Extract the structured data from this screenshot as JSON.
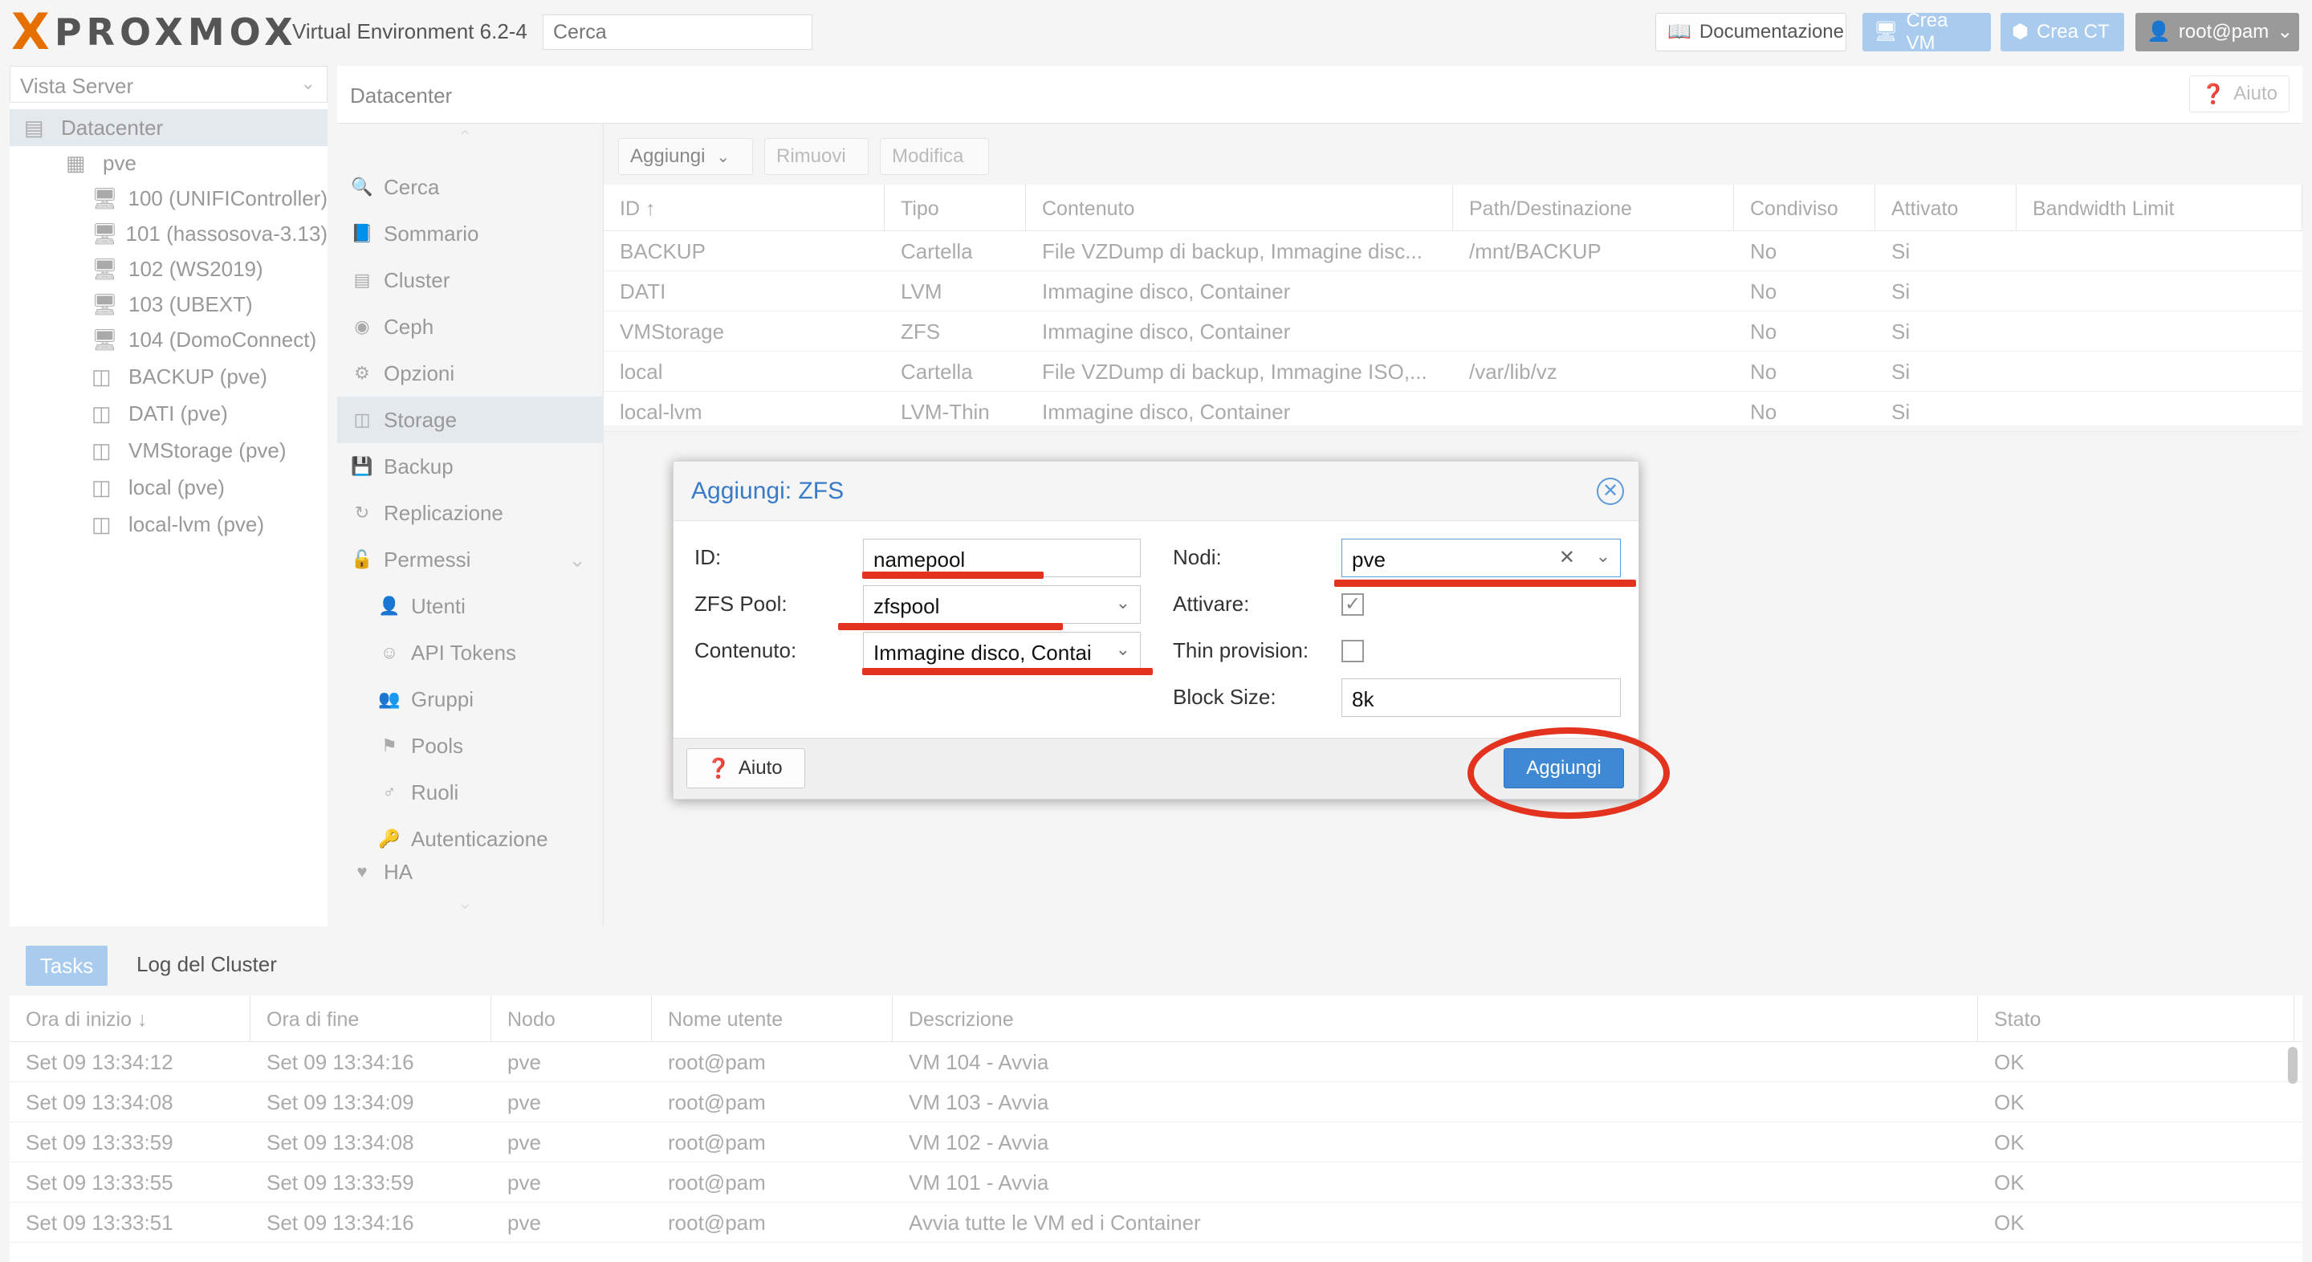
{
  "topbar": {
    "logo_x": "X",
    "logo_text": "PROXMOX",
    "version": "Virtual Environment 6.2-4",
    "search_placeholder": "Cerca",
    "buttons": {
      "docs": "Documentazione",
      "create_vm": "Crea VM",
      "create_ct": "Crea CT",
      "user": "root@pam"
    }
  },
  "tree": {
    "view_selector": "Vista Server",
    "items": [
      {
        "label": "Datacenter",
        "icon": "server-rack-icon"
      },
      {
        "label": "pve",
        "icon": "node-icon"
      },
      {
        "label": "100 (UNIFIController)",
        "icon": "vm-running-icon"
      },
      {
        "label": "101 (hassosova-3.13)",
        "icon": "vm-running-icon"
      },
      {
        "label": "102 (WS2019)",
        "icon": "vm-running-icon"
      },
      {
        "label": "103 (UBEXT)",
        "icon": "vm-running-icon"
      },
      {
        "label": "104 (DomoConnect)",
        "icon": "vm-running-icon"
      },
      {
        "label": "BACKUP (pve)",
        "icon": "storage-icon"
      },
      {
        "label": "DATI (pve)",
        "icon": "storage-icon"
      },
      {
        "label": "VMStorage (pve)",
        "icon": "storage-icon"
      },
      {
        "label": "local (pve)",
        "icon": "storage-icon"
      },
      {
        "label": "local-lvm (pve)",
        "icon": "storage-icon"
      }
    ]
  },
  "content": {
    "breadcrumb": "Datacenter",
    "help_button": "Aiuto",
    "nav": [
      {
        "label": "Cerca",
        "icon": "search-icon",
        "sub": false,
        "selected": false
      },
      {
        "label": "Sommario",
        "icon": "book-icon",
        "sub": false,
        "selected": false
      },
      {
        "label": "Cluster",
        "icon": "cluster-icon",
        "sub": false,
        "selected": false
      },
      {
        "label": "Ceph",
        "icon": "ceph-icon",
        "sub": false,
        "selected": false
      },
      {
        "label": "Opzioni",
        "icon": "gear-icon",
        "sub": false,
        "selected": false
      },
      {
        "label": "Storage",
        "icon": "database-icon",
        "sub": false,
        "selected": true
      },
      {
        "label": "Backup",
        "icon": "floppy-icon",
        "sub": false,
        "selected": false
      },
      {
        "label": "Replicazione",
        "icon": "retweet-icon",
        "sub": false,
        "selected": false
      },
      {
        "label": "Permessi",
        "icon": "unlock-icon",
        "sub": false,
        "selected": false
      },
      {
        "label": "Utenti",
        "icon": "user-icon",
        "sub": true,
        "selected": false
      },
      {
        "label": "API Tokens",
        "icon": "user-outline-icon",
        "sub": true,
        "selected": false
      },
      {
        "label": "Gruppi",
        "icon": "users-icon",
        "sub": true,
        "selected": false
      },
      {
        "label": "Pools",
        "icon": "tags-icon",
        "sub": true,
        "selected": false
      },
      {
        "label": "Ruoli",
        "icon": "male-icon",
        "sub": true,
        "selected": false
      },
      {
        "label": "Autenticazione",
        "icon": "key-icon",
        "sub": true,
        "selected": false
      },
      {
        "label": "HA",
        "icon": "heartbeat-icon",
        "sub": false,
        "selected": false
      }
    ],
    "toolbar": {
      "add": "Aggiungi",
      "remove": "Rimuovi",
      "edit": "Modifica"
    },
    "storage_grid": {
      "columns": [
        "ID ↑",
        "Tipo",
        "Contenuto",
        "Path/Destinazione",
        "Condiviso",
        "Attivato",
        "Bandwidth Limit"
      ],
      "rows": [
        [
          "BACKUP",
          "Cartella",
          "File VZDump di backup, Immagine disc...",
          "/mnt/BACKUP",
          "No",
          "Si",
          ""
        ],
        [
          "DATI",
          "LVM",
          "Immagine disco, Container",
          "",
          "No",
          "Si",
          ""
        ],
        [
          "VMStorage",
          "ZFS",
          "Immagine disco, Container",
          "",
          "No",
          "Si",
          ""
        ],
        [
          "local",
          "Cartella",
          "File VZDump di backup, Immagine ISO,...",
          "/var/lib/vz",
          "No",
          "Si",
          ""
        ],
        [
          "local-lvm",
          "LVM-Thin",
          "Immagine disco, Container",
          "",
          "No",
          "Si",
          ""
        ]
      ]
    }
  },
  "dialog": {
    "title": "Aggiungi: ZFS",
    "fields": {
      "id_label": "ID:",
      "id_value": "namepool",
      "pool_label": "ZFS Pool:",
      "pool_value": "zfspool",
      "content_label": "Contenuto:",
      "content_value": "Immagine disco, Contai",
      "nodes_label": "Nodi:",
      "nodes_value": "pve",
      "enable_label": "Attivare:",
      "enable_checked": true,
      "thin_label": "Thin provision:",
      "thin_checked": false,
      "block_label": "Block Size:",
      "block_value": "8k"
    },
    "help_button": "Aiuto",
    "add_button": "Aggiungi",
    "annotation_color": "#e3331f"
  },
  "tasks": {
    "tabs": [
      "Tasks",
      "Log del Cluster"
    ],
    "columns": [
      "Ora di inizio ↓",
      "Ora di fine",
      "Nodo",
      "Nome utente",
      "Descrizione",
      "Stato"
    ],
    "rows": [
      [
        "Set 09 13:34:12",
        "Set 09 13:34:16",
        "pve",
        "root@pam",
        "VM 104 - Avvia",
        "OK"
      ],
      [
        "Set 09 13:34:08",
        "Set 09 13:34:09",
        "pve",
        "root@pam",
        "VM 103 - Avvia",
        "OK"
      ],
      [
        "Set 09 13:33:59",
        "Set 09 13:34:08",
        "pve",
        "root@pam",
        "VM 102 - Avvia",
        "OK"
      ],
      [
        "Set 09 13:33:55",
        "Set 09 13:33:59",
        "pve",
        "root@pam",
        "VM 101 - Avvia",
        "OK"
      ],
      [
        "Set 09 13:33:51",
        "Set 09 13:34:16",
        "pve",
        "root@pam",
        "Avvia tutte le VM ed i Container",
        "OK"
      ]
    ]
  }
}
